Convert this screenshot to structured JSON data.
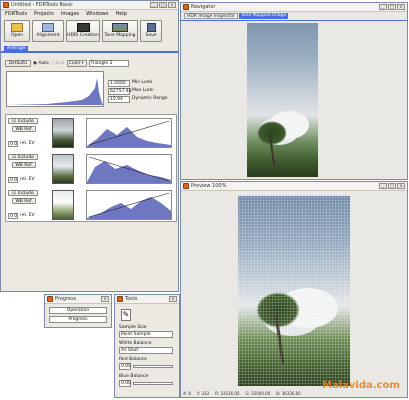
{
  "main": {
    "title": "Untitled - FDRTools Basic",
    "menu": [
      "FDRTools",
      "Projects",
      "Images",
      "Windows",
      "Help"
    ],
    "toolbar": [
      "Open",
      "Alignment",
      "HDRI Creation",
      "Tone Mapping",
      "Save"
    ],
    "tab": "Average",
    "controls": {
      "defaults": "Defaults",
      "auto": "Auto",
      "exif": "Exif",
      "color": "Color+",
      "triangle": "Triangle 2"
    },
    "stats": [
      {
        "value": "1.0000",
        "label": "Min Lumi"
      },
      {
        "value": "62757.48",
        "label": "Max Lumi"
      },
      {
        "value": "15.94",
        "label": "Dynamic Range"
      }
    ],
    "rows": [
      {
        "ev": "0.0"
      },
      {
        "ev": "0.0"
      },
      {
        "ev": "0.0"
      }
    ],
    "include": "Include",
    "wbref": "WB Ref.",
    "relev": "rel. EV"
  },
  "navigator": {
    "title": "Navigator",
    "tabs": [
      "HDR Image Inspector",
      "Tone Mapped Image"
    ]
  },
  "preview": {
    "title": "Preview 100%",
    "status": [
      "X: 8",
      "Y: 333",
      "R: 33536.00",
      "G: 32000.00",
      "B: 36336.00"
    ]
  },
  "progress": {
    "title": "Progress",
    "operation": "Operation",
    "progress": "Progress"
  },
  "tools": {
    "title": "Tools",
    "sample_size_label": "Sample Size",
    "sample_size": "Point Sample",
    "wb_label": "White Balance",
    "wb": "As Shot",
    "red_label": "Red Balance",
    "red": "0.00",
    "blue_label": "Blue Balance",
    "blue": "0.00"
  },
  "watermark": "Malavida.com",
  "colors": {
    "accent": "#4a6ee0",
    "hist": "#6f76c2",
    "window_bg": "#ece9e2"
  }
}
